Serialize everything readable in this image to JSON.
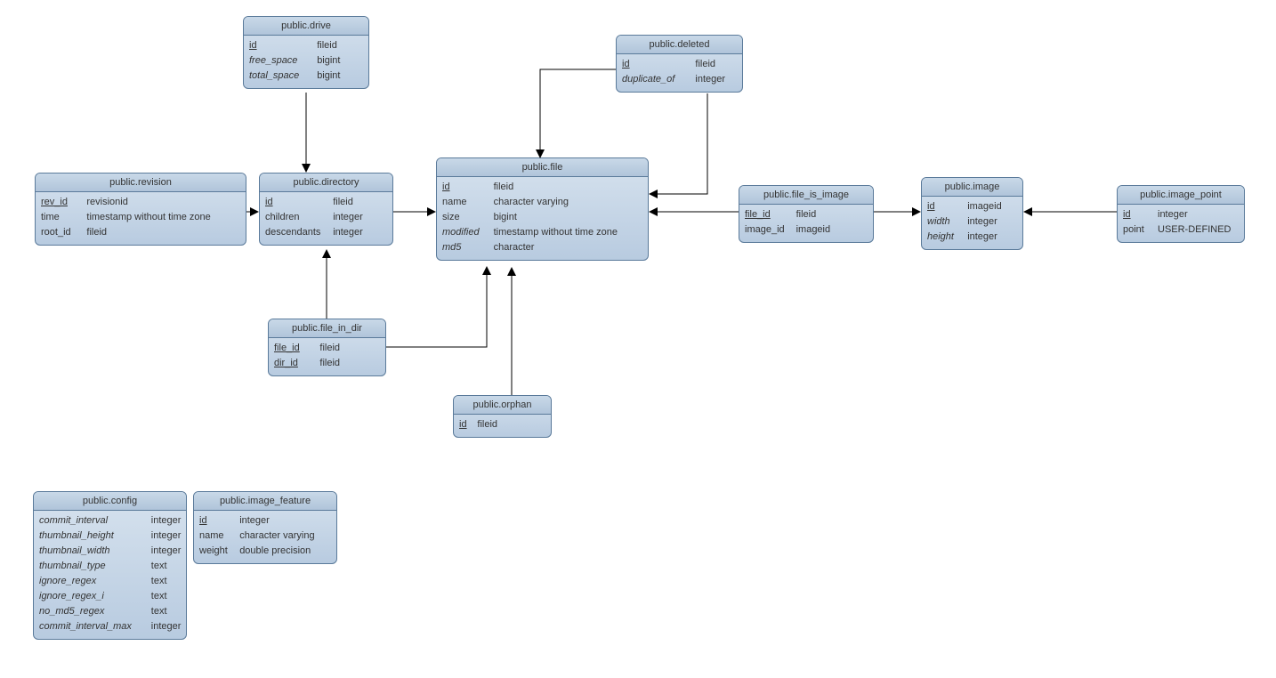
{
  "entities": {
    "drive": {
      "title": "public.drive",
      "cols": [
        {
          "name": "id",
          "type": "fileid",
          "pk": true
        },
        {
          "name": "free_space",
          "type": "bigint",
          "nullable": true
        },
        {
          "name": "total_space",
          "type": "bigint",
          "nullable": true
        }
      ]
    },
    "revision": {
      "title": "public.revision",
      "cols": [
        {
          "name": "rev_id",
          "type": "revisionid",
          "pk": true
        },
        {
          "name": "time",
          "type": "timestamp without time zone"
        },
        {
          "name": "root_id",
          "type": "fileid"
        }
      ]
    },
    "directory": {
      "title": "public.directory",
      "cols": [
        {
          "name": "id",
          "type": "fileid",
          "pk": true
        },
        {
          "name": "children",
          "type": "integer"
        },
        {
          "name": "descendants",
          "type": "integer"
        }
      ]
    },
    "deleted": {
      "title": "public.deleted",
      "cols": [
        {
          "name": "id",
          "type": "fileid",
          "pk": true
        },
        {
          "name": "duplicate_of",
          "type": "integer",
          "nullable": true
        }
      ]
    },
    "file": {
      "title": "public.file",
      "cols": [
        {
          "name": "id",
          "type": "fileid",
          "pk": true
        },
        {
          "name": "name",
          "type": "character varying"
        },
        {
          "name": "size",
          "type": "bigint"
        },
        {
          "name": "modified",
          "type": "timestamp without time zone",
          "nullable": true
        },
        {
          "name": "md5",
          "type": "character",
          "nullable": true
        }
      ]
    },
    "file_is_image": {
      "title": "public.file_is_image",
      "cols": [
        {
          "name": "file_id",
          "type": "fileid",
          "pk": true
        },
        {
          "name": "image_id",
          "type": "imageid"
        }
      ]
    },
    "image": {
      "title": "public.image",
      "cols": [
        {
          "name": "id",
          "type": "imageid",
          "pk": true
        },
        {
          "name": "width",
          "type": "integer",
          "nullable": true
        },
        {
          "name": "height",
          "type": "integer",
          "nullable": true
        }
      ]
    },
    "image_point": {
      "title": "public.image_point",
      "cols": [
        {
          "name": "id",
          "type": "integer",
          "pk": true
        },
        {
          "name": "point",
          "type": "USER-DEFINED"
        }
      ]
    },
    "file_in_dir": {
      "title": "public.file_in_dir",
      "cols": [
        {
          "name": "file_id",
          "type": "fileid",
          "pk": true
        },
        {
          "name": "dir_id",
          "type": "fileid",
          "pk": true
        }
      ]
    },
    "orphan": {
      "title": "public.orphan",
      "cols": [
        {
          "name": "id",
          "type": "fileid",
          "pk": true
        }
      ]
    },
    "config": {
      "title": "public.config",
      "cols": [
        {
          "name": "commit_interval",
          "type": "integer",
          "nullable": true
        },
        {
          "name": "thumbnail_height",
          "type": "integer",
          "nullable": true
        },
        {
          "name": "thumbnail_width",
          "type": "integer",
          "nullable": true
        },
        {
          "name": "thumbnail_type",
          "type": "text",
          "nullable": true
        },
        {
          "name": "ignore_regex",
          "type": "text",
          "nullable": true
        },
        {
          "name": "ignore_regex_i",
          "type": "text",
          "nullable": true
        },
        {
          "name": "no_md5_regex",
          "type": "text",
          "nullable": true
        },
        {
          "name": "commit_interval_max",
          "type": "integer",
          "nullable": true
        }
      ]
    },
    "image_feature": {
      "title": "public.image_feature",
      "cols": [
        {
          "name": "id",
          "type": "integer",
          "pk": true
        },
        {
          "name": "name",
          "type": "character varying"
        },
        {
          "name": "weight",
          "type": "double precision"
        }
      ]
    }
  }
}
